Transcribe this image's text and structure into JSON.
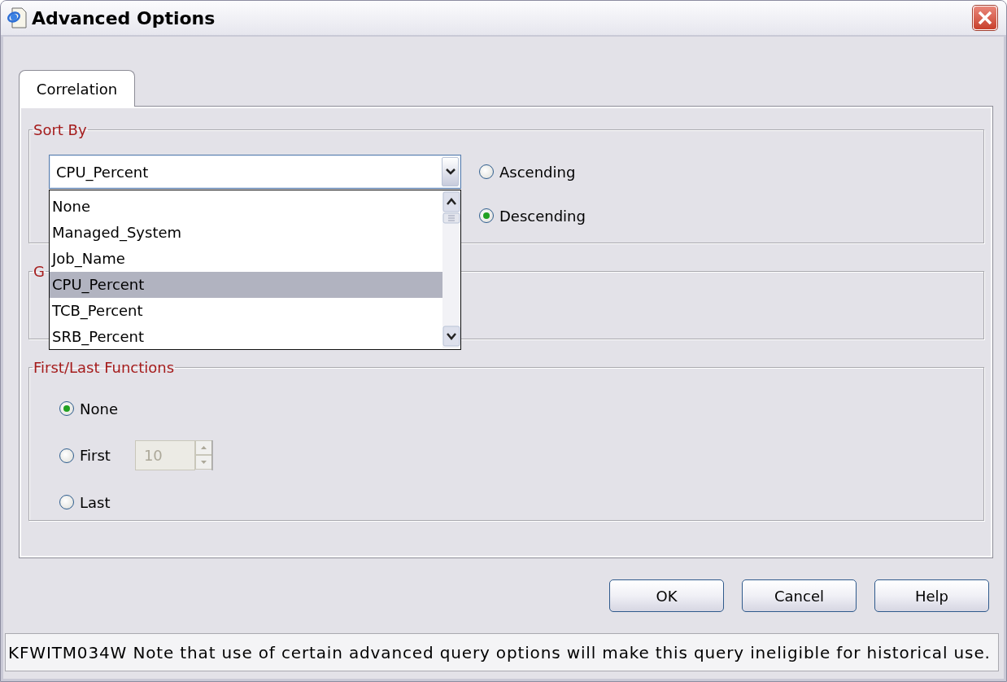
{
  "window": {
    "title": "Advanced Options"
  },
  "tabs": [
    {
      "label": "Correlation",
      "selected": true
    }
  ],
  "sort_by": {
    "legend": "Sort By",
    "field": {
      "value": "CPU_Percent",
      "expanded": true
    },
    "options": [
      {
        "label": "None",
        "selected": false
      },
      {
        "label": "Managed_System",
        "selected": false
      },
      {
        "label": "Job_Name",
        "selected": false
      },
      {
        "label": "CPU_Percent",
        "selected": true
      },
      {
        "label": "TCB_Percent",
        "selected": false
      },
      {
        "label": "SRB_Percent",
        "selected": false
      }
    ],
    "order": [
      {
        "label": "Ascending",
        "selected": false
      },
      {
        "label": "Descending",
        "selected": true
      }
    ]
  },
  "group_2": {
    "legend": "G"
  },
  "first_last": {
    "legend": "First/Last Functions",
    "options": [
      {
        "label": "None",
        "selected": true
      },
      {
        "label": "First",
        "selected": false
      },
      {
        "label": "Last",
        "selected": false
      }
    ],
    "count": {
      "value": "10",
      "disabled": true
    }
  },
  "buttons": [
    "OK",
    "Cancel",
    "Help"
  ],
  "status_bar": "KFWITM034W Note that use of certain advanced query options will make this query ineligible for historical use."
}
